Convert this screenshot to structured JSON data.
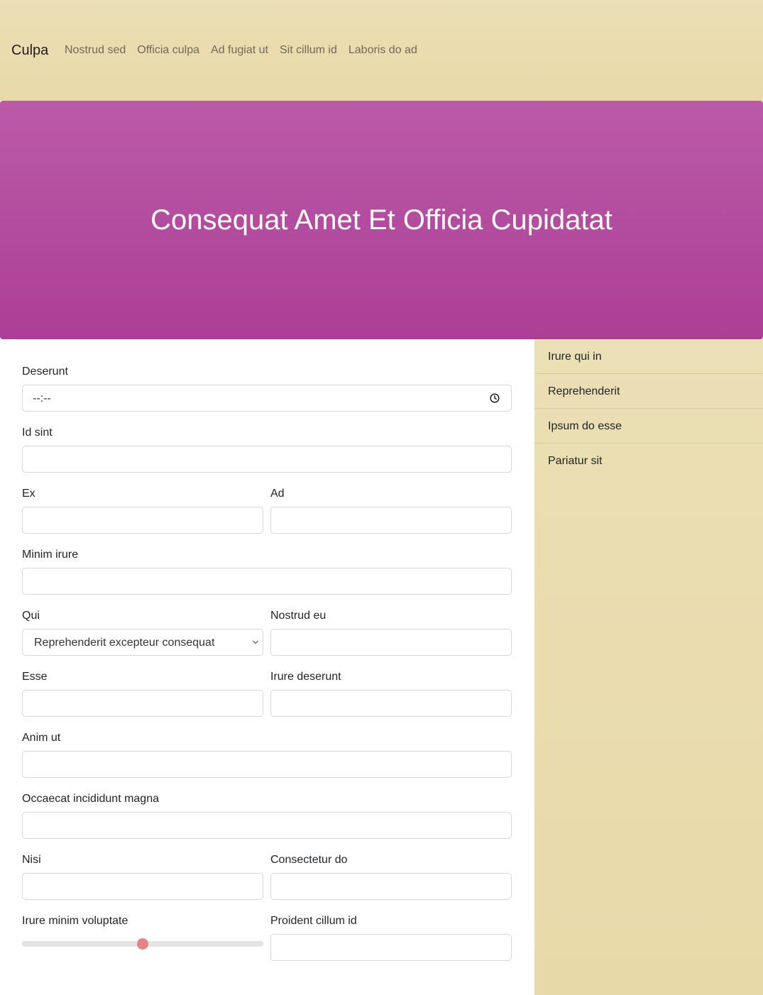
{
  "navbar": {
    "brand": "Culpa",
    "links": [
      "Nostrud sed",
      "Officia culpa",
      "Ad fugiat ut",
      "Sit cillum id",
      "Laboris do ad"
    ]
  },
  "hero": {
    "title": "Consequat Amet Et Officia Cupidatat"
  },
  "form": {
    "deserunt": {
      "label": "Deserunt",
      "value": "--:--",
      "icon": "clock-icon"
    },
    "id_sint": {
      "label": "Id sint",
      "value": ""
    },
    "ex": {
      "label": "Ex",
      "value": ""
    },
    "ad": {
      "label": "Ad",
      "value": ""
    },
    "minim_irure": {
      "label": "Minim irure",
      "value": ""
    },
    "qui": {
      "label": "Qui",
      "selected": "Reprehenderit excepteur consequat"
    },
    "nostrud_eu": {
      "label": "Nostrud eu",
      "value": ""
    },
    "esse": {
      "label": "Esse",
      "value": ""
    },
    "irure_deserunt": {
      "label": "Irure deserunt",
      "value": ""
    },
    "anim_ut": {
      "label": "Anim ut",
      "value": ""
    },
    "occaecat": {
      "label": "Occaecat incididunt magna",
      "value": ""
    },
    "nisi": {
      "label": "Nisi",
      "value": ""
    },
    "consectetur_do": {
      "label": "Consectetur do",
      "value": ""
    },
    "irure_minim": {
      "label": "Irure minim voluptate",
      "level": 0.5
    },
    "proident": {
      "label": "Proident cillum id",
      "value": ""
    }
  },
  "sidebar": {
    "items": [
      "Irure qui in",
      "Reprehenderit",
      "Ipsum do esse",
      "Pariatur sit"
    ]
  },
  "colors": {
    "nav_bg": "#e9dcad",
    "hero_bg": "#b34e9d",
    "slider_thumb": "#e88383"
  }
}
